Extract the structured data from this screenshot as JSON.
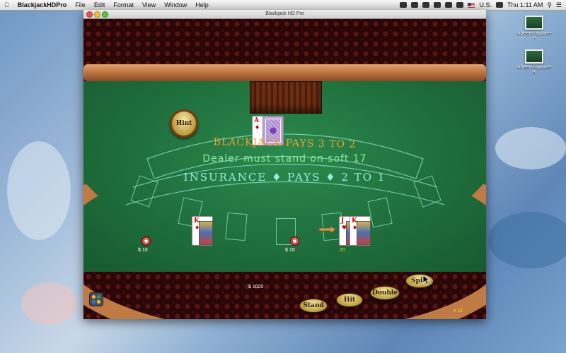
{
  "menubar": {
    "app_name": "BlackjackHDPro",
    "items": [
      "File",
      "Edit",
      "Format",
      "View",
      "Window",
      "Help"
    ],
    "input_source": "U.S.",
    "clock": "Thu 1:11 AM"
  },
  "window": {
    "title": "Blackjack HD Pro"
  },
  "table": {
    "hint_label": "Hint",
    "banner_blackjack": "BLACKJACK  PAYS 3 TO 2",
    "banner_dealer": "Dealer must stand on soft 17",
    "banner_insurance": "INSURANCE  ♦  PAYS  ♦  2 TO 1",
    "dealer_card_rank": "A",
    "hand_left_card_rank": "K",
    "hand_right_card1_rank": "J",
    "hand_right_card2_rank": "K",
    "bet_left": "$ 10",
    "bet_center": "$ 10",
    "hand_total": "20",
    "bankroll": "$ 1020",
    "round_number": "# 11"
  },
  "actions": {
    "stand": "Stand",
    "hit": "Hit",
    "double": "Double",
    "split": "Split"
  },
  "desktop": {
    "icons": [
      {
        "label": "screen-capture-7"
      },
      {
        "label": "screen-capture-8"
      }
    ]
  },
  "colors": {
    "felt": "#1f6e3c",
    "rail": "#c07a44",
    "banner_gold": "#f0a030",
    "banner_cyan": "#8ff0e0"
  }
}
